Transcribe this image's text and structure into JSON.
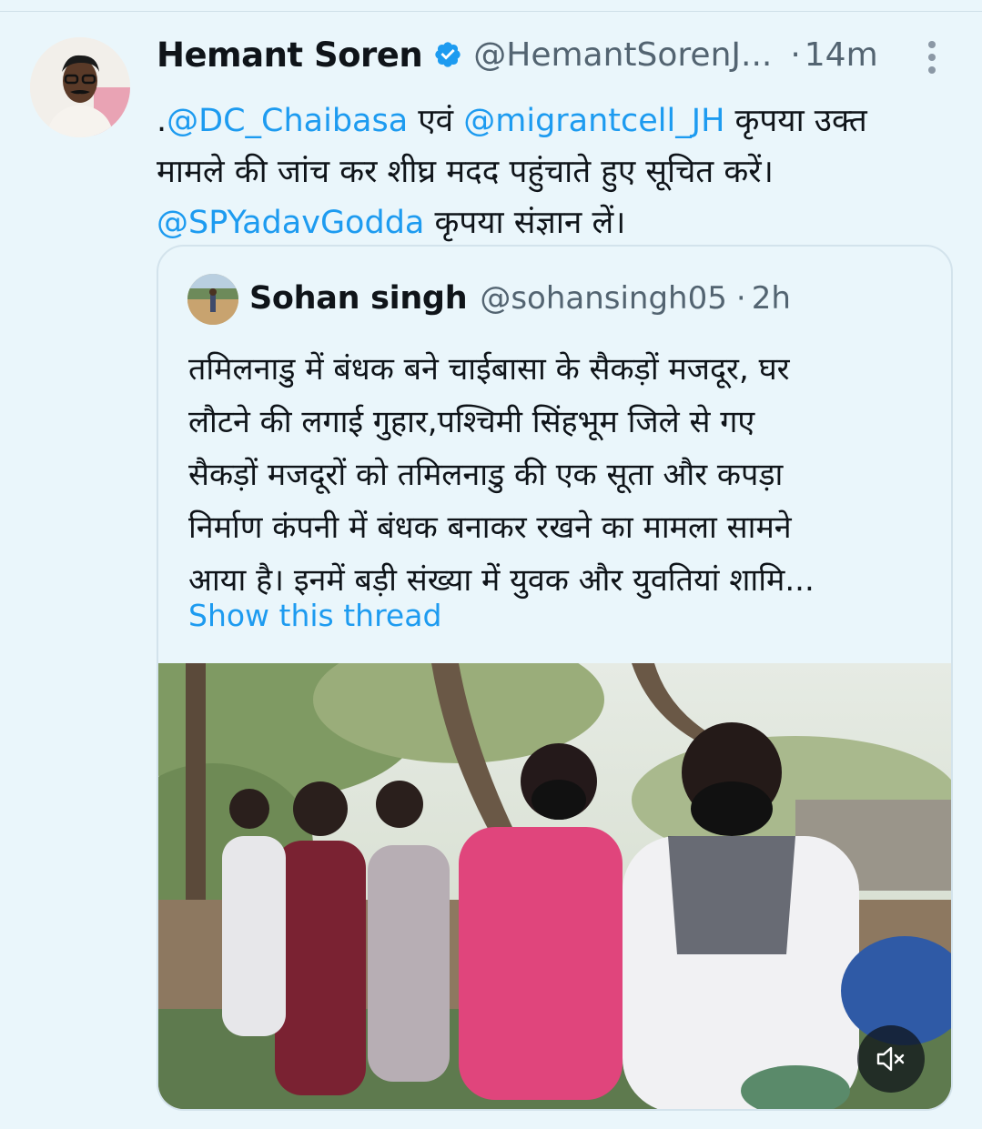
{
  "tweet": {
    "author_name": "Hemant Soren",
    "verified": true,
    "handle": "@HemantSorenJ...",
    "separator": "·",
    "time": "14m",
    "text": {
      "l1_prefix": ".",
      "l1_mention1": "@DC_Chaibasa",
      "l1_mid": " एवं ",
      "l1_mention2": "@migrantcell_JH",
      "l1_suffix": " कृपया उक्त",
      "l2": "मामले की जांच कर शीघ्र मदद पहुंचाते हुए सूचित करें।",
      "l3_mention": "@SPYadavGodda",
      "l3_suffix": " कृपया संज्ञान लें।"
    }
  },
  "quoted": {
    "author_name": "Sohan singh",
    "handle": "@sohansingh05",
    "separator": "·",
    "time": "2h",
    "lines": [
      "तमिलनाडु में बंधक बने चाईबासा के सैकड़ों मजदूर, घर",
      "लौटने की लगाई गुहार,पश्चिमी सिंहभूम जिले से गए",
      "सैकड़ों मजदूरों को तमिलनाडु की एक सूता और कपड़ा",
      "निर्माण कंपनी में बंधक बनाकर रखने का मामला सामने",
      "आया है। इनमें बड़ी संख्या में युवक और युवतियां शामि..."
    ],
    "show_thread": "Show this thread"
  },
  "colors": {
    "background": "#eaf6fb",
    "link": "#1d9bf0",
    "secondary_text": "#536471",
    "verified_badge": "#1d9bf0"
  },
  "icons": {
    "verified": "verified-badge-icon",
    "more": "more-vertical-icon",
    "mute": "speaker-muted-icon"
  }
}
